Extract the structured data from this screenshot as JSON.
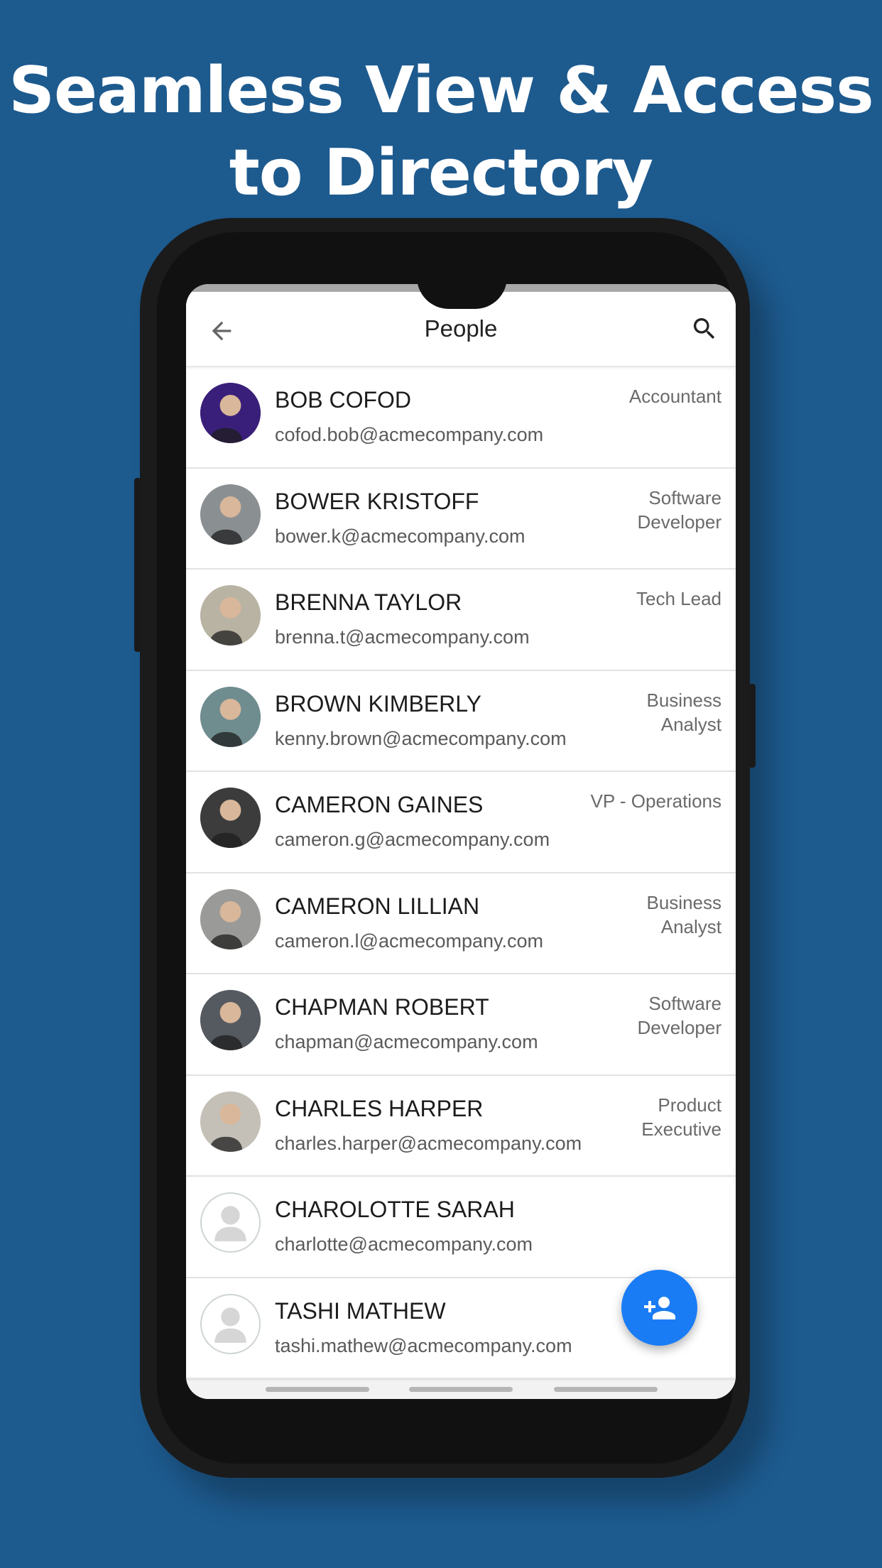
{
  "headline": {
    "line1": "Seamless View & Access",
    "line2": "to Directory"
  },
  "appbar": {
    "title": "People",
    "back_icon": "arrow-left-icon",
    "search_icon": "search-icon"
  },
  "people": [
    {
      "name": "BOB COFOD",
      "email": "cofod.bob@acmecompany.com",
      "role": [
        "Accountant"
      ],
      "avatar": "photo",
      "color": "#3a1f7a"
    },
    {
      "name": "BOWER KRISTOFF",
      "email": "bower.k@acmecompany.com",
      "role": [
        "Software",
        "Developer"
      ],
      "avatar": "photo",
      "color": "#8a8f92"
    },
    {
      "name": "BRENNA TAYLOR",
      "email": "brenna.t@acmecompany.com",
      "role": [
        "Tech Lead"
      ],
      "avatar": "photo",
      "color": "#b9b3a3"
    },
    {
      "name": "BROWN KIMBERLY",
      "email": "kenny.brown@acmecompany.com",
      "role": [
        "Business",
        "Analyst"
      ],
      "avatar": "photo",
      "color": "#6f8c8f"
    },
    {
      "name": "CAMERON GAINES",
      "email": "cameron.g@acmecompany.com",
      "role": [
        "VP - Operations"
      ],
      "avatar": "photo",
      "color": "#3c3c3c"
    },
    {
      "name": "CAMERON LILLIAN",
      "email": "cameron.l@acmecompany.com",
      "role": [
        "Business",
        "Analyst"
      ],
      "avatar": "photo",
      "color": "#9a9a98"
    },
    {
      "name": "CHAPMAN ROBERT",
      "email": "chapman@acmecompany.com",
      "role": [
        "Software",
        "Developer"
      ],
      "avatar": "photo",
      "color": "#555a60"
    },
    {
      "name": "CHARLES HARPER",
      "email": "charles.harper@acmecompany.com",
      "role": [
        "Product",
        "Executive"
      ],
      "avatar": "photo",
      "color": "#c4c0b8"
    },
    {
      "name": "CHAROLOTTE SARAH",
      "email": "charlotte@acmecompany.com",
      "role": [],
      "avatar": "placeholder"
    },
    {
      "name": "TASHI MATHEW",
      "email": "tashi.mathew@acmecompany.com",
      "role": [],
      "avatar": "placeholder"
    }
  ],
  "fab": {
    "icon": "add-person-icon",
    "color": "#1a7cf5"
  },
  "colors": {
    "background": "#1d5a8e",
    "accent": "#1a7cf5"
  }
}
